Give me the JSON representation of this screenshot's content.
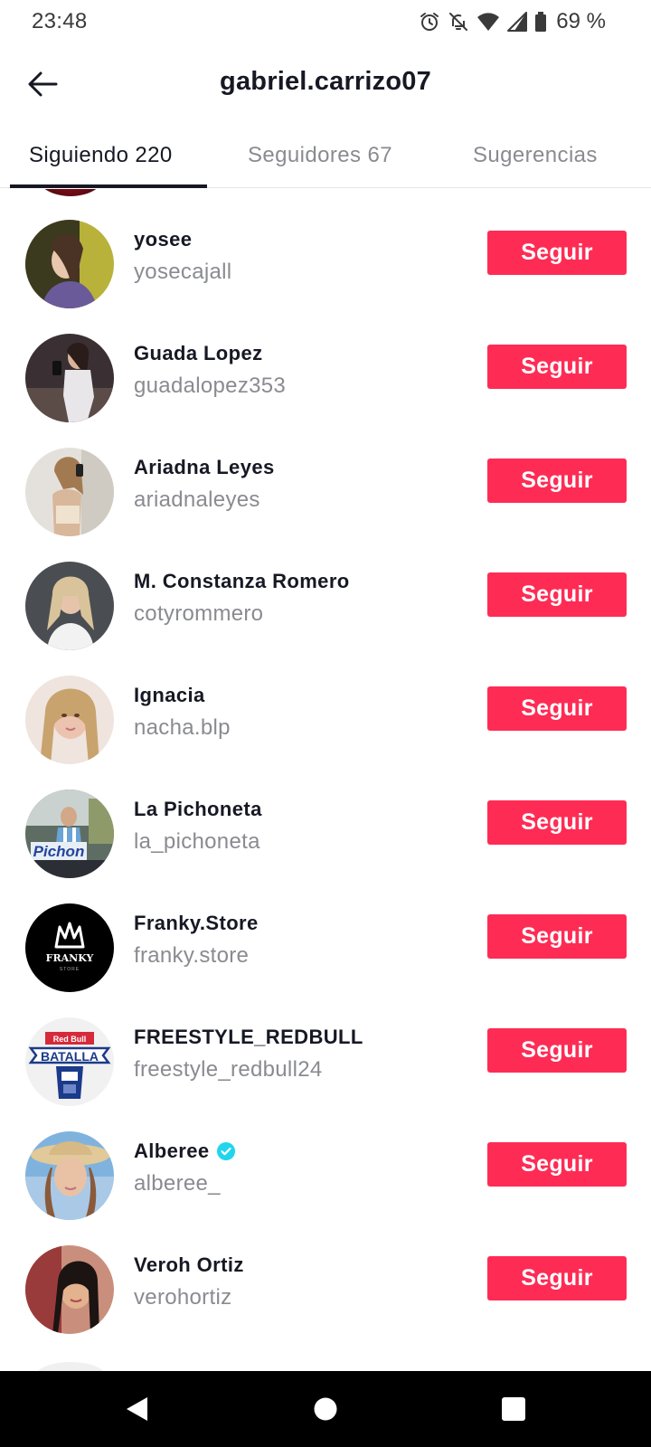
{
  "status_bar": {
    "time": "23:48",
    "battery": "69 %",
    "icons": [
      "alarm-icon",
      "notifications-off-icon",
      "wifi-icon",
      "signal-icon",
      "battery-icon"
    ]
  },
  "header": {
    "title": "gabriel.carrizo07",
    "back_icon": "arrow-left-icon"
  },
  "tabs": [
    {
      "label": "Siguiendo 220",
      "active": true
    },
    {
      "label": "Seguidores 67",
      "active": false
    },
    {
      "label": "Sugerencias",
      "active": false
    }
  ],
  "colors": {
    "accent": "#fe2c55",
    "text_primary": "#161823",
    "text_secondary": "#8a8b91",
    "verified": "#20d5ec"
  },
  "users": [
    {
      "name": "yosee",
      "username": "yosecajall",
      "verified": false,
      "button": "Seguir"
    },
    {
      "name": "Guada Lopez",
      "username": "guadalopez353",
      "verified": false,
      "button": "Seguir"
    },
    {
      "name": "Ariadna Leyes",
      "username": "ariadnaleyes",
      "verified": false,
      "button": "Seguir"
    },
    {
      "name": "M. Constanza Romero",
      "username": "cotyrommero",
      "verified": false,
      "button": "Seguir"
    },
    {
      "name": "Ignacia",
      "username": "nacha.blp",
      "verified": false,
      "button": "Seguir"
    },
    {
      "name": "La Pichoneta",
      "username": "la_pichoneta",
      "verified": false,
      "button": "Seguir"
    },
    {
      "name": "Franky.Store",
      "username": "franky.store",
      "verified": false,
      "button": "Seguir"
    },
    {
      "name": "FREESTYLE_REDBULL",
      "username": "freestyle_redbull24",
      "verified": false,
      "button": "Seguir"
    },
    {
      "name": "Alberee",
      "username": "alberee_",
      "verified": true,
      "button": "Seguir"
    },
    {
      "name": "Veroh Ortiz",
      "username": "verohortiz",
      "verified": false,
      "button": "Seguir"
    }
  ],
  "avatar_logos": {
    "pichon": "Pichon",
    "franky": "FRANKY",
    "franky_sub": "STORE",
    "redbull_top": "Red Bull",
    "redbull_main": "BATALLA"
  },
  "nav_bar": {
    "icons": [
      "nav-back-icon",
      "nav-home-icon",
      "nav-recents-icon"
    ]
  }
}
